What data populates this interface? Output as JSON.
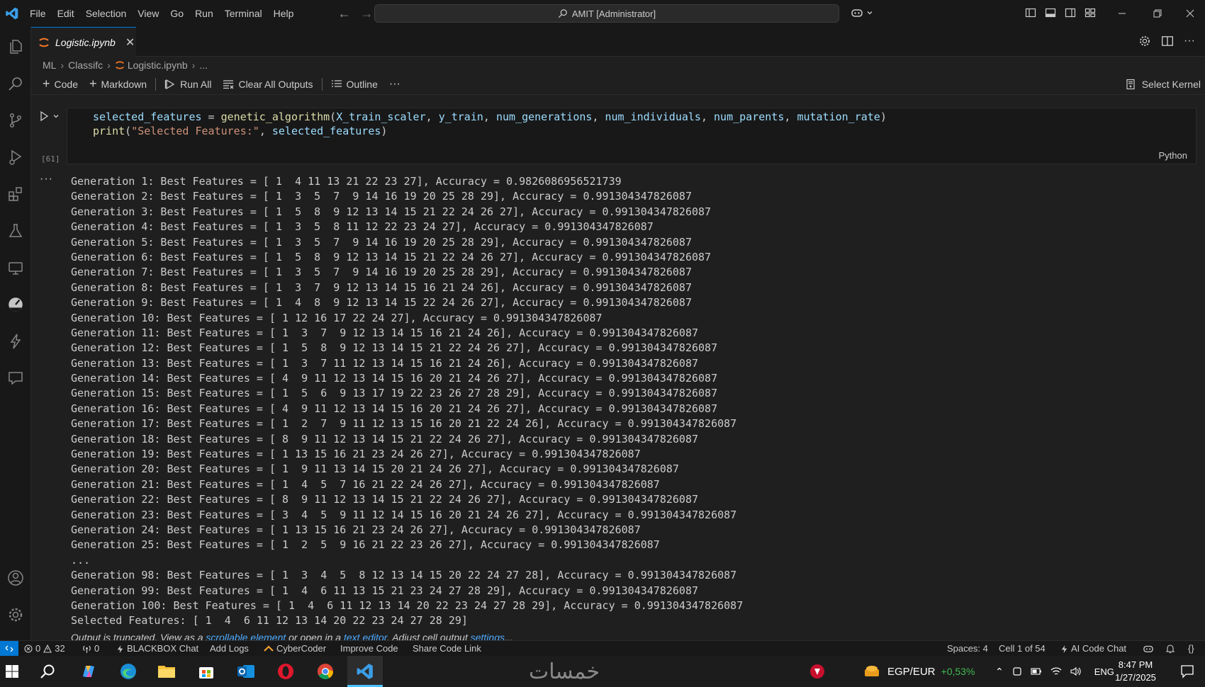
{
  "menu": [
    "File",
    "Edit",
    "Selection",
    "View",
    "Go",
    "Run",
    "Terminal",
    "Help"
  ],
  "command_center": "AMIT [Administrator]",
  "tab": {
    "title": "Logistic.ipynb"
  },
  "breadcrumb": [
    "ML",
    "Classifc",
    "Logistic.ipynb",
    "..."
  ],
  "toolbar": {
    "code": "Code",
    "markdown": "Markdown",
    "run_all": "Run All",
    "clear_outputs": "Clear All Outputs",
    "outline": "Outline",
    "more": "···",
    "select_kernel": "Select Kernel"
  },
  "cell": {
    "execution_count": "[61]",
    "language": "Python",
    "code": [
      [
        {
          "t": "selected_features",
          "c": "var"
        },
        {
          "t": " = ",
          "c": "pl"
        },
        {
          "t": "genetic_algorithm",
          "c": "fn"
        },
        {
          "t": "(",
          "c": "pl"
        },
        {
          "t": "X_train_scaler",
          "c": "var"
        },
        {
          "t": ", ",
          "c": "pl"
        },
        {
          "t": "y_train",
          "c": "var"
        },
        {
          "t": ", ",
          "c": "pl"
        },
        {
          "t": "num_generations",
          "c": "var"
        },
        {
          "t": ", ",
          "c": "pl"
        },
        {
          "t": "num_individuals",
          "c": "var"
        },
        {
          "t": ", ",
          "c": "pl"
        },
        {
          "t": "num_parents",
          "c": "var"
        },
        {
          "t": ", ",
          "c": "pl"
        },
        {
          "t": "mutation_rate",
          "c": "var"
        },
        {
          "t": ")",
          "c": "pl"
        }
      ],
      [
        {
          "t": "print",
          "c": "fn"
        },
        {
          "t": "(",
          "c": "pl"
        },
        {
          "t": "\"Selected Features:\"",
          "c": "str"
        },
        {
          "t": ", ",
          "c": "pl"
        },
        {
          "t": "selected_features",
          "c": "var"
        },
        {
          "t": ")",
          "c": "pl"
        }
      ]
    ]
  },
  "output": {
    "more_label": "···",
    "lines": [
      "Generation 1: Best Features = [ 1  4 11 13 21 22 23 27], Accuracy = 0.9826086956521739",
      "Generation 2: Best Features = [ 1  3  5  7  9 14 16 19 20 25 28 29], Accuracy = 0.991304347826087",
      "Generation 3: Best Features = [ 1  5  8  9 12 13 14 15 21 22 24 26 27], Accuracy = 0.991304347826087",
      "Generation 4: Best Features = [ 1  3  5  8 11 12 22 23 24 27], Accuracy = 0.991304347826087",
      "Generation 5: Best Features = [ 1  3  5  7  9 14 16 19 20 25 28 29], Accuracy = 0.991304347826087",
      "Generation 6: Best Features = [ 1  5  8  9 12 13 14 15 21 22 24 26 27], Accuracy = 0.991304347826087",
      "Generation 7: Best Features = [ 1  3  5  7  9 14 16 19 20 25 28 29], Accuracy = 0.991304347826087",
      "Generation 8: Best Features = [ 1  3  7  9 12 13 14 15 16 21 24 26], Accuracy = 0.991304347826087",
      "Generation 9: Best Features = [ 1  4  8  9 12 13 14 15 22 24 26 27], Accuracy = 0.991304347826087",
      "Generation 10: Best Features = [ 1 12 16 17 22 24 27], Accuracy = 0.991304347826087",
      "Generation 11: Best Features = [ 1  3  7  9 12 13 14 15 16 21 24 26], Accuracy = 0.991304347826087",
      "Generation 12: Best Features = [ 1  5  8  9 12 13 14 15 21 22 24 26 27], Accuracy = 0.991304347826087",
      "Generation 13: Best Features = [ 1  3  7 11 12 13 14 15 16 21 24 26], Accuracy = 0.991304347826087",
      "Generation 14: Best Features = [ 4  9 11 12 13 14 15 16 20 21 24 26 27], Accuracy = 0.991304347826087",
      "Generation 15: Best Features = [ 1  5  6  9 13 17 19 22 23 26 27 28 29], Accuracy = 0.991304347826087",
      "Generation 16: Best Features = [ 4  9 11 12 13 14 15 16 20 21 24 26 27], Accuracy = 0.991304347826087",
      "Generation 17: Best Features = [ 1  2  7  9 11 12 13 15 16 20 21 22 24 26], Accuracy = 0.991304347826087",
      "Generation 18: Best Features = [ 8  9 11 12 13 14 15 21 22 24 26 27], Accuracy = 0.991304347826087",
      "Generation 19: Best Features = [ 1 13 15 16 21 23 24 26 27], Accuracy = 0.991304347826087",
      "Generation 20: Best Features = [ 1  9 11 13 14 15 20 21 24 26 27], Accuracy = 0.991304347826087",
      "Generation 21: Best Features = [ 1  4  5  7 16 21 22 24 26 27], Accuracy = 0.991304347826087",
      "Generation 22: Best Features = [ 8  9 11 12 13 14 15 21 22 24 26 27], Accuracy = 0.991304347826087",
      "Generation 23: Best Features = [ 3  4  5  9 11 12 14 15 16 20 21 24 26 27], Accuracy = 0.991304347826087",
      "Generation 24: Best Features = [ 1 13 15 16 21 23 24 26 27], Accuracy = 0.991304347826087",
      "Generation 25: Best Features = [ 1  2  5  9 16 21 22 23 26 27], Accuracy = 0.991304347826087",
      "...",
      "Generation 98: Best Features = [ 1  3  4  5  8 12 13 14 15 20 22 24 27 28], Accuracy = 0.991304347826087",
      "Generation 99: Best Features = [ 1  4  6 11 13 15 21 23 24 27 28 29], Accuracy = 0.991304347826087",
      "Generation 100: Best Features = [ 1  4  6 11 12 13 14 20 22 23 24 27 28 29], Accuracy = 0.991304347826087",
      "Selected Features: [ 1  4  6 11 12 13 14 20 22 23 24 27 28 29]"
    ],
    "truncated": {
      "prefix": "Output is truncated. View as a ",
      "link1": "scrollable element",
      "middle": " or open in a ",
      "link2": "text editor",
      "suffix": ". Adjust cell output ",
      "link3": "settings",
      "end": "..."
    }
  },
  "statusbar": {
    "errors": "0",
    "warnings": "32",
    "ports": "0",
    "blackbox": "BLACKBOX Chat",
    "add_logs": "Add Logs",
    "cybercoder": "CyberCoder",
    "improve_code": "Improve Code",
    "share_code": "Share Code Link",
    "spaces": "Spaces: 4",
    "cell_pos": "Cell 1 of 54",
    "ai_chat": "AI Code Chat"
  },
  "taskbar": {
    "currency": "EGP/EUR",
    "change": "+0,53%",
    "lang": "ENG",
    "time": "8:47 PM",
    "date": "1/27/2025",
    "watermark": "خمسات"
  },
  "colors": {
    "accent": "#0078d4",
    "var": "#9cdcfe",
    "fn": "#dcdcaa",
    "str": "#ce9178",
    "link": "#4daafc",
    "change_positive": "#3fb950"
  }
}
